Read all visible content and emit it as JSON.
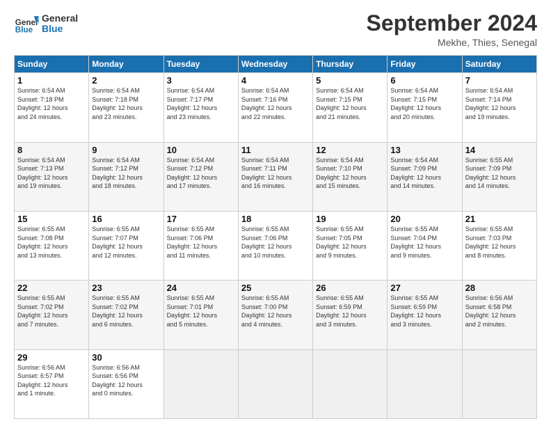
{
  "header": {
    "logo_general": "General",
    "logo_blue": "Blue",
    "month": "September 2024",
    "location": "Mekhe, Thies, Senegal"
  },
  "days_of_week": [
    "Sunday",
    "Monday",
    "Tuesday",
    "Wednesday",
    "Thursday",
    "Friday",
    "Saturday"
  ],
  "weeks": [
    [
      {
        "day": "1",
        "info": "Sunrise: 6:54 AM\nSunset: 7:18 PM\nDaylight: 12 hours\nand 24 minutes."
      },
      {
        "day": "2",
        "info": "Sunrise: 6:54 AM\nSunset: 7:18 PM\nDaylight: 12 hours\nand 23 minutes."
      },
      {
        "day": "3",
        "info": "Sunrise: 6:54 AM\nSunset: 7:17 PM\nDaylight: 12 hours\nand 23 minutes."
      },
      {
        "day": "4",
        "info": "Sunrise: 6:54 AM\nSunset: 7:16 PM\nDaylight: 12 hours\nand 22 minutes."
      },
      {
        "day": "5",
        "info": "Sunrise: 6:54 AM\nSunset: 7:15 PM\nDaylight: 12 hours\nand 21 minutes."
      },
      {
        "day": "6",
        "info": "Sunrise: 6:54 AM\nSunset: 7:15 PM\nDaylight: 12 hours\nand 20 minutes."
      },
      {
        "day": "7",
        "info": "Sunrise: 6:54 AM\nSunset: 7:14 PM\nDaylight: 12 hours\nand 19 minutes."
      }
    ],
    [
      {
        "day": "8",
        "info": "Sunrise: 6:54 AM\nSunset: 7:13 PM\nDaylight: 12 hours\nand 19 minutes."
      },
      {
        "day": "9",
        "info": "Sunrise: 6:54 AM\nSunset: 7:12 PM\nDaylight: 12 hours\nand 18 minutes."
      },
      {
        "day": "10",
        "info": "Sunrise: 6:54 AM\nSunset: 7:12 PM\nDaylight: 12 hours\nand 17 minutes."
      },
      {
        "day": "11",
        "info": "Sunrise: 6:54 AM\nSunset: 7:11 PM\nDaylight: 12 hours\nand 16 minutes."
      },
      {
        "day": "12",
        "info": "Sunrise: 6:54 AM\nSunset: 7:10 PM\nDaylight: 12 hours\nand 15 minutes."
      },
      {
        "day": "13",
        "info": "Sunrise: 6:54 AM\nSunset: 7:09 PM\nDaylight: 12 hours\nand 14 minutes."
      },
      {
        "day": "14",
        "info": "Sunrise: 6:55 AM\nSunset: 7:09 PM\nDaylight: 12 hours\nand 14 minutes."
      }
    ],
    [
      {
        "day": "15",
        "info": "Sunrise: 6:55 AM\nSunset: 7:08 PM\nDaylight: 12 hours\nand 13 minutes."
      },
      {
        "day": "16",
        "info": "Sunrise: 6:55 AM\nSunset: 7:07 PM\nDaylight: 12 hours\nand 12 minutes."
      },
      {
        "day": "17",
        "info": "Sunrise: 6:55 AM\nSunset: 7:06 PM\nDaylight: 12 hours\nand 11 minutes."
      },
      {
        "day": "18",
        "info": "Sunrise: 6:55 AM\nSunset: 7:06 PM\nDaylight: 12 hours\nand 10 minutes."
      },
      {
        "day": "19",
        "info": "Sunrise: 6:55 AM\nSunset: 7:05 PM\nDaylight: 12 hours\nand 9 minutes."
      },
      {
        "day": "20",
        "info": "Sunrise: 6:55 AM\nSunset: 7:04 PM\nDaylight: 12 hours\nand 9 minutes."
      },
      {
        "day": "21",
        "info": "Sunrise: 6:55 AM\nSunset: 7:03 PM\nDaylight: 12 hours\nand 8 minutes."
      }
    ],
    [
      {
        "day": "22",
        "info": "Sunrise: 6:55 AM\nSunset: 7:02 PM\nDaylight: 12 hours\nand 7 minutes."
      },
      {
        "day": "23",
        "info": "Sunrise: 6:55 AM\nSunset: 7:02 PM\nDaylight: 12 hours\nand 6 minutes."
      },
      {
        "day": "24",
        "info": "Sunrise: 6:55 AM\nSunset: 7:01 PM\nDaylight: 12 hours\nand 5 minutes."
      },
      {
        "day": "25",
        "info": "Sunrise: 6:55 AM\nSunset: 7:00 PM\nDaylight: 12 hours\nand 4 minutes."
      },
      {
        "day": "26",
        "info": "Sunrise: 6:55 AM\nSunset: 6:59 PM\nDaylight: 12 hours\nand 3 minutes."
      },
      {
        "day": "27",
        "info": "Sunrise: 6:55 AM\nSunset: 6:59 PM\nDaylight: 12 hours\nand 3 minutes."
      },
      {
        "day": "28",
        "info": "Sunrise: 6:56 AM\nSunset: 6:58 PM\nDaylight: 12 hours\nand 2 minutes."
      }
    ],
    [
      {
        "day": "29",
        "info": "Sunrise: 6:56 AM\nSunset: 6:57 PM\nDaylight: 12 hours\nand 1 minute."
      },
      {
        "day": "30",
        "info": "Sunrise: 6:56 AM\nSunset: 6:56 PM\nDaylight: 12 hours\nand 0 minutes."
      },
      {
        "day": "",
        "info": ""
      },
      {
        "day": "",
        "info": ""
      },
      {
        "day": "",
        "info": ""
      },
      {
        "day": "",
        "info": ""
      },
      {
        "day": "",
        "info": ""
      }
    ]
  ]
}
